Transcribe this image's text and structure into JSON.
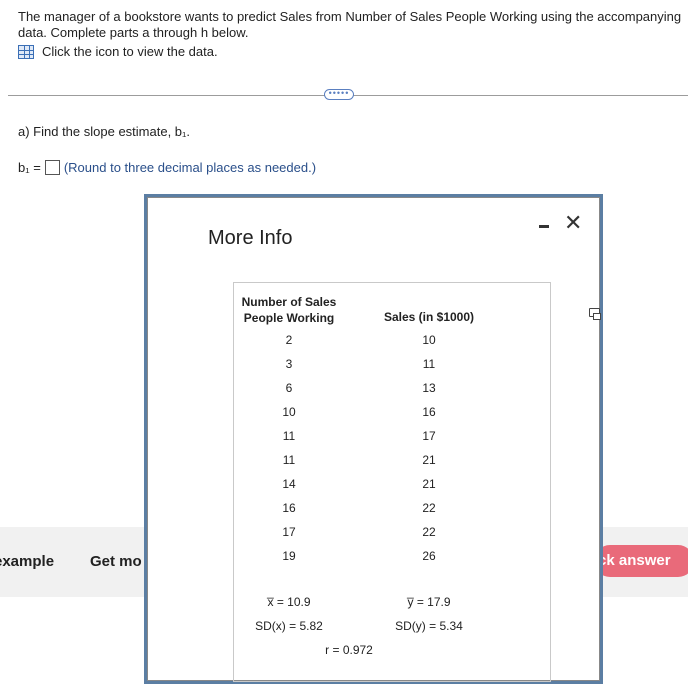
{
  "problem": {
    "text": "The manager of a bookstore wants to predict Sales from Number of Sales People Working using the accompanying data. Complete parts a through h below.",
    "data_link": "Click the icon to view the data."
  },
  "divider": {
    "handle": "•••••"
  },
  "question": {
    "text": "a) Find the slope estimate, b₁.",
    "answer_label": "b₁ =",
    "hint": "(Round to three decimal places as needed.)"
  },
  "bottom_bar": {
    "example": "example",
    "get_more": "Get mo",
    "check_answer": "ck answer"
  },
  "dialog": {
    "title": "More Info",
    "minimize": "–",
    "close": "✕",
    "table": {
      "header_x": "Number of Sales People Working",
      "header_y": "Sales (in $1000)",
      "x": [
        "2",
        "3",
        "6",
        "10",
        "11",
        "11",
        "14",
        "16",
        "17",
        "19"
      ],
      "y": [
        "10",
        "11",
        "13",
        "16",
        "17",
        "21",
        "21",
        "22",
        "22",
        "26"
      ],
      "x_mean": "x̅ = 10.9",
      "y_mean": "y̅ = 17.9",
      "sd_x": "SD(x) = 5.82",
      "sd_y": "SD(y) = 5.34",
      "r": "r = 0.972"
    }
  }
}
